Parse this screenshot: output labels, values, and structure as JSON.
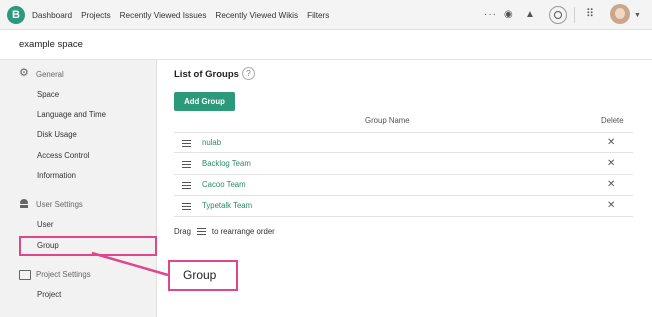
{
  "topnav": {
    "logo_glyph": "B",
    "links": [
      "Dashboard",
      "Projects",
      "Recently Viewed Issues",
      "Recently Viewed Wikis",
      "Filters"
    ],
    "icons": [
      "more-icon",
      "watch-icon",
      "notification-icon",
      "search-icon",
      "apps-grid-icon",
      "avatar",
      "chevron-down-icon"
    ]
  },
  "space": {
    "name": "example space"
  },
  "sidebar": {
    "general": {
      "label": "General",
      "items": [
        "Space",
        "Language and Time",
        "Disk Usage",
        "Access Control",
        "Information"
      ]
    },
    "user_settings": {
      "label": "User Settings",
      "items": [
        "User",
        "Group"
      ]
    },
    "project_settings": {
      "label": "Project Settings",
      "items": [
        "Project"
      ]
    }
  },
  "main": {
    "title": "List of Groups",
    "help_glyph": "?",
    "add_button": "Add Group",
    "columns": {
      "name": "Group Name",
      "delete": "Delete"
    },
    "groups": [
      "nulab",
      "Backlog Team",
      "Cacoo Team",
      "Typetalk Team"
    ],
    "hint_before": "Drag",
    "hint_after": "to rearrange order"
  },
  "callout": {
    "label": "Group"
  },
  "colors": {
    "accent": "#2c9a7a",
    "highlight": "#e0478a",
    "link": "#2c8a6e"
  }
}
